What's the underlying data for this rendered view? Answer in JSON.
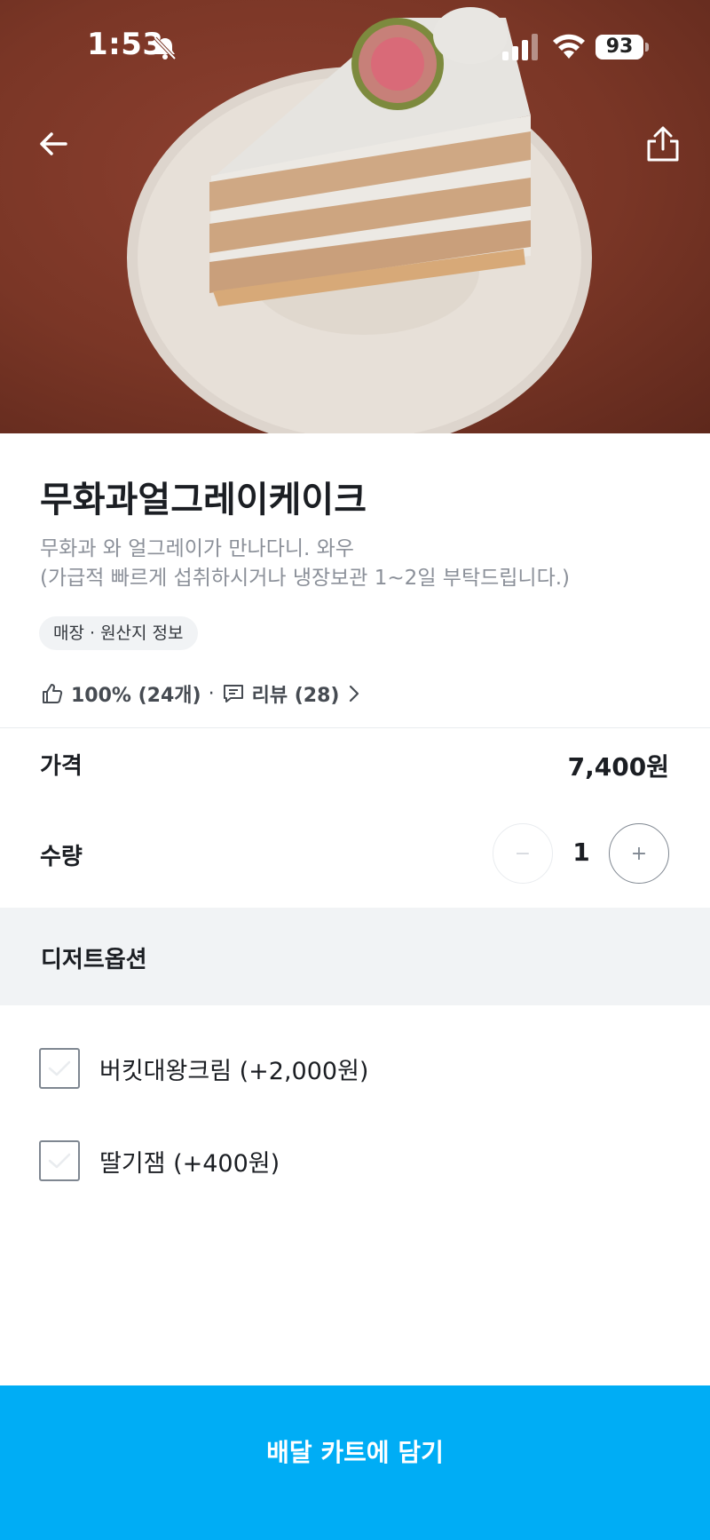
{
  "status_bar": {
    "time": "1:53",
    "battery": "93"
  },
  "product": {
    "title": "무화과얼그레이케이크",
    "description_line1": "무화과 와 얼그레이가 만나다니. 와우",
    "description_line2": "(가급적 빠르게 섭취하시거나 냉장보관 1~2일 부탁드립니다.)",
    "origin_chip": "매장 · 원산지 정보",
    "rating_text": "100% (24개)",
    "separator": "·",
    "review_text": "리뷰 (28)"
  },
  "price": {
    "label": "가격",
    "value": "7,400원"
  },
  "quantity": {
    "label": "수량",
    "value": "1",
    "minus": "−",
    "plus": "+"
  },
  "options": {
    "header": "디저트옵션",
    "items": [
      {
        "label": "버킷대왕크림 (+2,000원)",
        "checked": false
      },
      {
        "label": "딸기잼 (+400원)",
        "checked": false
      }
    ]
  },
  "cta": {
    "label": "배달 카트에 담기"
  },
  "colors": {
    "accent": "#00adf5",
    "background_image": "#7a3626"
  },
  "icons": [
    "back-arrow-icon",
    "share-icon",
    "thumbs-up-icon",
    "comment-icon",
    "chevron-right-icon",
    "checkmark-icon",
    "bell-off-icon",
    "signal-icon",
    "wifi-icon"
  ]
}
